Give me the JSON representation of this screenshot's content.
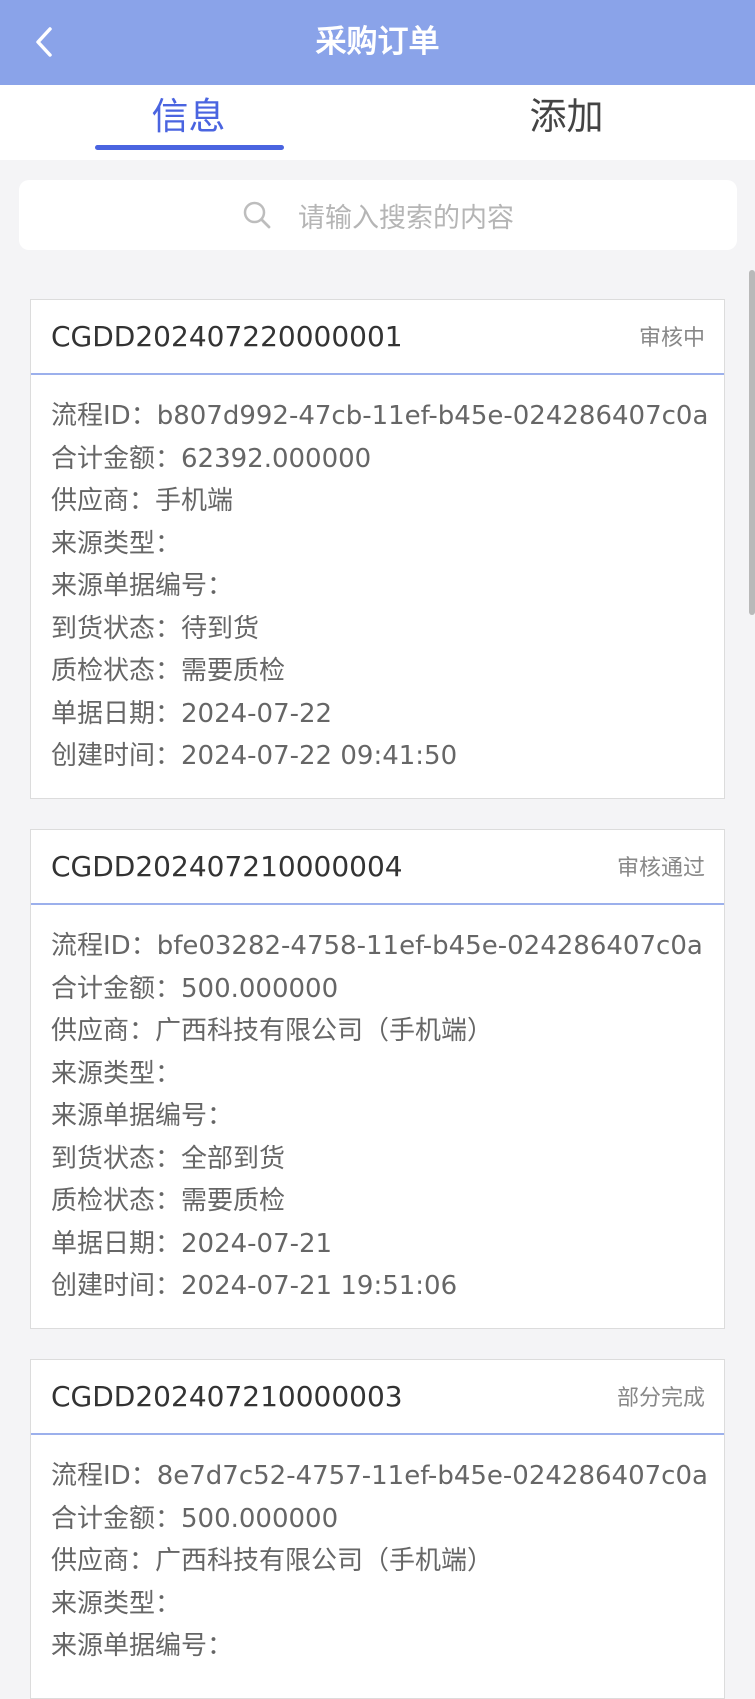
{
  "header": {
    "title": "采购订单"
  },
  "tabs": [
    {
      "label": "信息"
    },
    {
      "label": "添加"
    }
  ],
  "search": {
    "placeholder": "请输入搜索的内容"
  },
  "orders": [
    {
      "code": "CGDD202407220000001",
      "status": "审核中",
      "fields": [
        "流程ID：b807d992-47cb-11ef-b45e-024286407c0a",
        "合计金额：62392.000000",
        "供应商：手机端",
        "来源类型：",
        "来源单据编号：",
        "到货状态：待到货",
        "质检状态：需要质检",
        "单据日期：2024-07-22",
        "创建时间：2024-07-22 09:41:50"
      ]
    },
    {
      "code": "CGDD202407210000004",
      "status": "审核通过",
      "fields": [
        "流程ID：bfe03282-4758-11ef-b45e-024286407c0a",
        "合计金额：500.000000",
        "供应商：广西科技有限公司（手机端）",
        "来源类型：",
        "来源单据编号：",
        "到货状态：全部到货",
        "质检状态：需要质检",
        "单据日期：2024-07-21",
        "创建时间：2024-07-21 19:51:06"
      ]
    },
    {
      "code": "CGDD202407210000003",
      "status": "部分完成",
      "fields": [
        "流程ID：8e7d7c52-4757-11ef-b45e-024286407c0a",
        "合计金额：500.000000",
        "供应商：广西科技有限公司（手机端）",
        "来源类型：",
        "来源单据编号："
      ]
    }
  ]
}
